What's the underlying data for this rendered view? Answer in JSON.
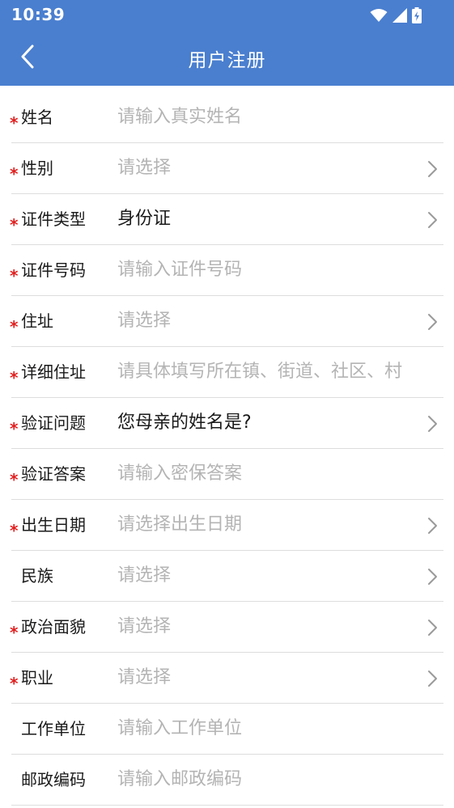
{
  "status_bar": {
    "time": "10:39"
  },
  "header": {
    "title": "用户注册",
    "back_icon": "chevron-left-icon"
  },
  "colors": {
    "header_bg": "#4a7fcf",
    "required": "#e02020",
    "placeholder": "#b4b4b4",
    "text": "#1a1a1a"
  },
  "form": {
    "fields": [
      {
        "label": "姓名",
        "required": true,
        "kind": "input",
        "placeholder": "请输入真实姓名",
        "value": ""
      },
      {
        "label": "性别",
        "required": true,
        "kind": "select",
        "placeholder": "请选择",
        "value": ""
      },
      {
        "label": "证件类型",
        "required": true,
        "kind": "select",
        "placeholder": "",
        "value": "身份证"
      },
      {
        "label": "证件号码",
        "required": true,
        "kind": "input",
        "placeholder": "请输入证件号码",
        "value": ""
      },
      {
        "label": "住址",
        "required": true,
        "kind": "select",
        "placeholder": "请选择",
        "value": ""
      },
      {
        "label": "详细住址",
        "required": true,
        "kind": "input",
        "placeholder": "请具体填写所在镇、街道、社区、村",
        "value": ""
      },
      {
        "label": "验证问题",
        "required": true,
        "kind": "select",
        "placeholder": "",
        "value": "您母亲的姓名是?"
      },
      {
        "label": "验证答案",
        "required": true,
        "kind": "input",
        "placeholder": "请输入密保答案",
        "value": ""
      },
      {
        "label": "出生日期",
        "required": true,
        "kind": "select",
        "placeholder": "请选择出生日期",
        "value": ""
      },
      {
        "label": "民族",
        "required": false,
        "kind": "select",
        "placeholder": "请选择",
        "value": ""
      },
      {
        "label": "政治面貌",
        "required": true,
        "kind": "select",
        "placeholder": "请选择",
        "value": ""
      },
      {
        "label": "职业",
        "required": true,
        "kind": "select",
        "placeholder": "请选择",
        "value": ""
      },
      {
        "label": "工作单位",
        "required": false,
        "kind": "input",
        "placeholder": "请输入工作单位",
        "value": ""
      },
      {
        "label": "邮政编码",
        "required": false,
        "kind": "input",
        "placeholder": "请输入邮政编码",
        "value": ""
      }
    ],
    "required_mark": "*",
    "arrow_icon": "chevron-right-icon"
  }
}
